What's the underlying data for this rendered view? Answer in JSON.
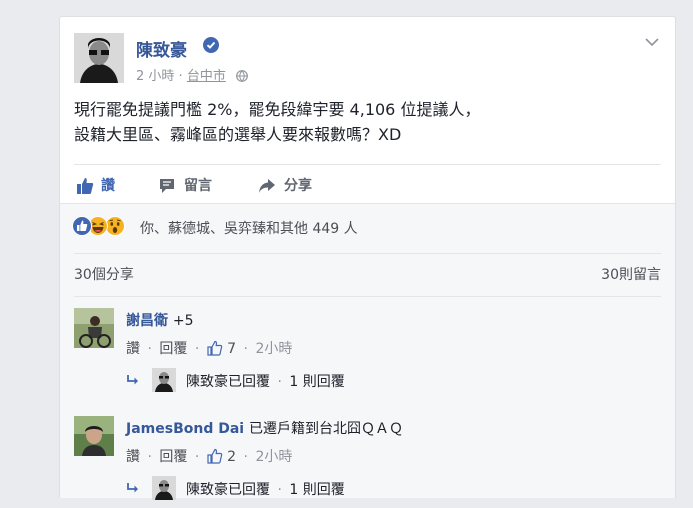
{
  "post": {
    "author": "陳致豪",
    "time": "2 小時",
    "separator": "·",
    "location": "台中市",
    "text_line1": "現行罷免提議門檻 2%，罷免段緯宇要 4,106 位提議人，",
    "text_line2": "設籍大里區、霧峰區的選舉人要來報數嗎？XD"
  },
  "actions": {
    "like": "讚",
    "comment": "留言",
    "share": "分享"
  },
  "reactions": {
    "summary": "你、蘇德城、吳弈臻和其他 449 人"
  },
  "counts": {
    "shares": "30個分享",
    "comments": "30則留言"
  },
  "comments": [
    {
      "author": "謝昌衛",
      "text": "+5",
      "like": "讚",
      "reply": "回覆",
      "like_count": "7",
      "time": "2小時",
      "sep": "·",
      "reply_summary": "陳致豪已回覆",
      "reply_count": "1 則回覆"
    },
    {
      "author": "JamesBond Dai",
      "text": "已遷戶籍到台北囧ＱＡＱ",
      "like": "讚",
      "reply": "回覆",
      "like_count": "2",
      "time": "2小時",
      "sep": "·",
      "reply_summary": "陳致豪已回覆",
      "reply_count": "1 則回覆"
    }
  ],
  "colors": {
    "link": "#365899",
    "like_blue": "#4267b2",
    "muted": "#90949c",
    "background": "#e9ebee"
  },
  "icons": [
    "verified-badge-icon",
    "chevron-down-icon",
    "globe-icon",
    "like-thumb-icon",
    "comment-bubble-icon",
    "share-arrow-icon",
    "like-reaction-icon",
    "haha-reaction-icon",
    "wow-reaction-icon",
    "reply-arrow-icon"
  ]
}
